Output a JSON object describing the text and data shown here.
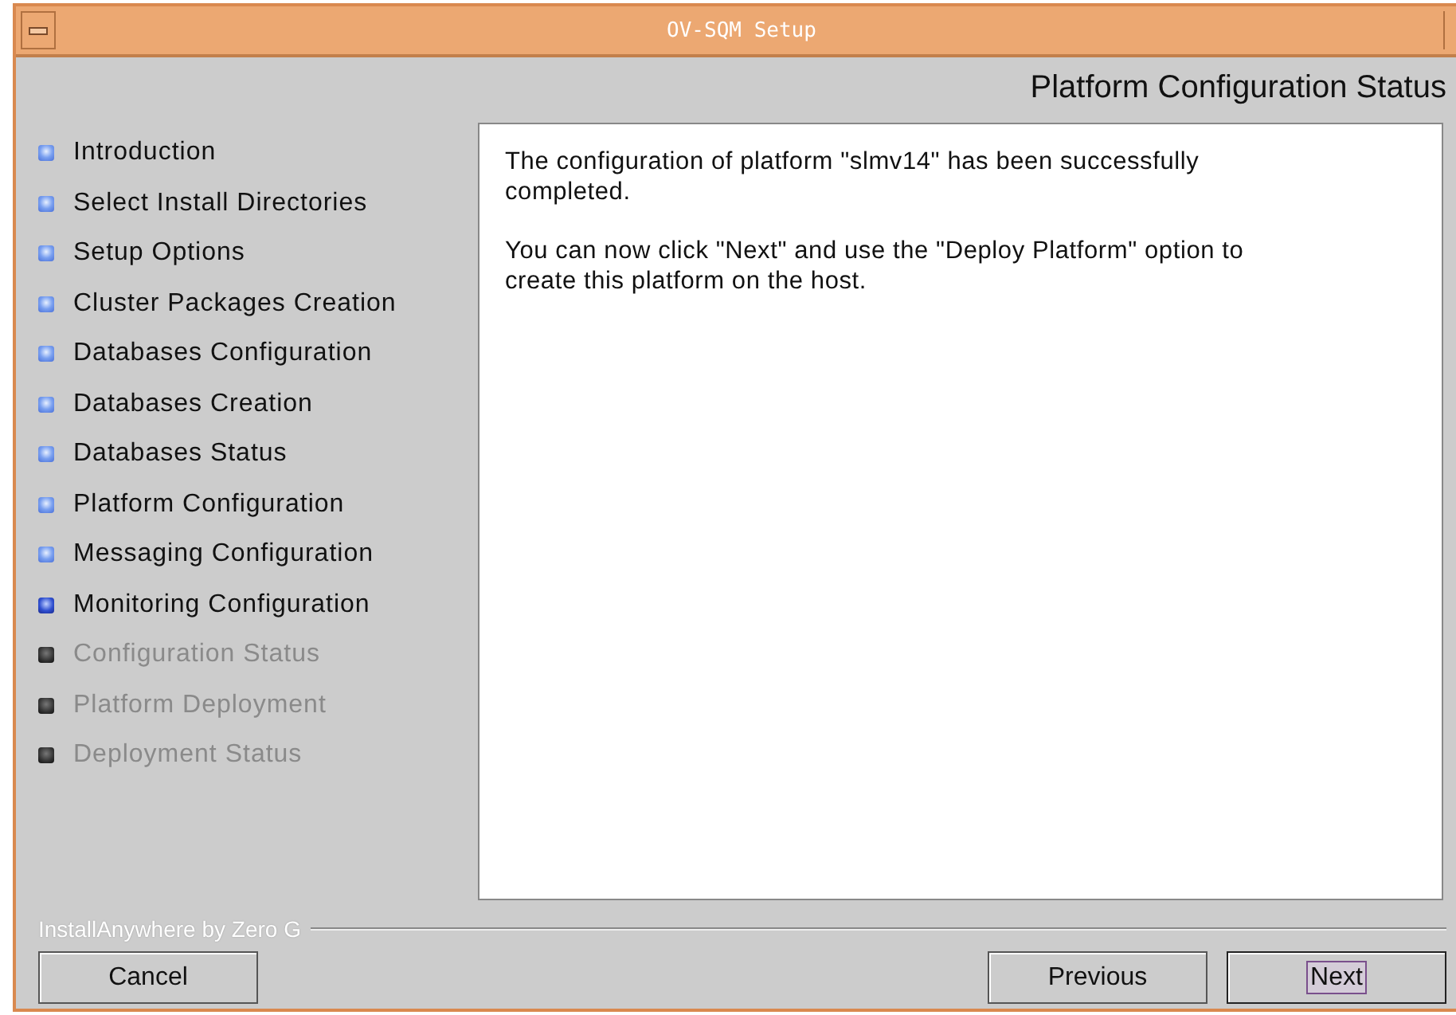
{
  "window": {
    "title": "OV-SQM Setup"
  },
  "heading": "Platform Configuration Status",
  "steps": [
    {
      "label": "Introduction",
      "kind": "done"
    },
    {
      "label": "Select Install Directories",
      "kind": "done"
    },
    {
      "label": "Setup Options",
      "kind": "done"
    },
    {
      "label": "Cluster Packages Creation",
      "kind": "done"
    },
    {
      "label": "Databases Configuration",
      "kind": "done"
    },
    {
      "label": "Databases Creation",
      "kind": "done"
    },
    {
      "label": "Databases Status",
      "kind": "done"
    },
    {
      "label": "Platform Configuration",
      "kind": "done"
    },
    {
      "label": "Messaging Configuration",
      "kind": "done"
    },
    {
      "label": "Monitoring Configuration",
      "kind": "current"
    },
    {
      "label": "Configuration Status",
      "kind": "pending"
    },
    {
      "label": "Platform Deployment",
      "kind": "pending"
    },
    {
      "label": "Deployment Status",
      "kind": "pending"
    }
  ],
  "message": [
    "The configuration of platform \"slmv14\" has been successfully completed.",
    "You can now click \"Next\" and use the \"Deploy Platform\" option to create this platform on the host."
  ],
  "vendor": "InstallAnywhere by Zero G",
  "buttons": {
    "left": [
      {
        "label": "Cancel",
        "focused": false
      }
    ],
    "right": [
      {
        "label": "Previous",
        "focused": false
      },
      {
        "label": "Next",
        "focused": true
      }
    ]
  }
}
